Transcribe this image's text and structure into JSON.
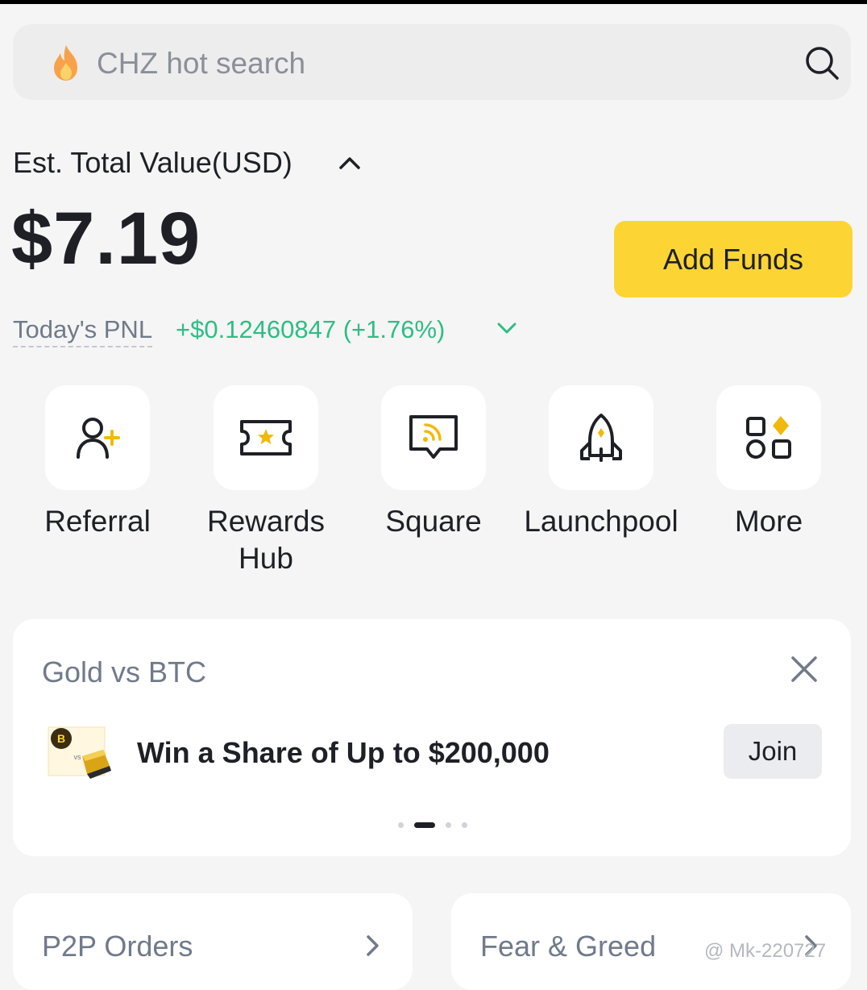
{
  "search": {
    "placeholder": "CHZ hot search",
    "leading_icon": "fire-icon",
    "trailing_icon": "search-icon"
  },
  "account": {
    "est_total_label": "Est. Total Value(USD)",
    "total_value": "$7.19",
    "add_funds_label": "Add Funds",
    "pnl_label": "Today's PNL",
    "pnl_value": "+$0.12460847 (+1.76%)"
  },
  "shortcuts": [
    {
      "label": "Referral",
      "icon": "referral-icon"
    },
    {
      "label": "Rewards Hub",
      "icon": "ticket-icon"
    },
    {
      "label": "Square",
      "icon": "square-feed-icon"
    },
    {
      "label": "Launchpool",
      "icon": "rocket-icon"
    },
    {
      "label": "More",
      "icon": "grid-icon"
    }
  ],
  "promo": {
    "title": "Gold vs BTC",
    "text": "Win a Share of Up to $200,000",
    "join_label": "Join",
    "page_count": 4,
    "active_page": 2
  },
  "cards": [
    {
      "title": "P2P Orders"
    },
    {
      "title": "Fear & Greed"
    }
  ],
  "watermark": "@ Mk-220727",
  "colors": {
    "accent": "#fcd535",
    "positive": "#2ebd85",
    "text_primary": "#1e2026",
    "text_secondary": "#707a8a"
  }
}
